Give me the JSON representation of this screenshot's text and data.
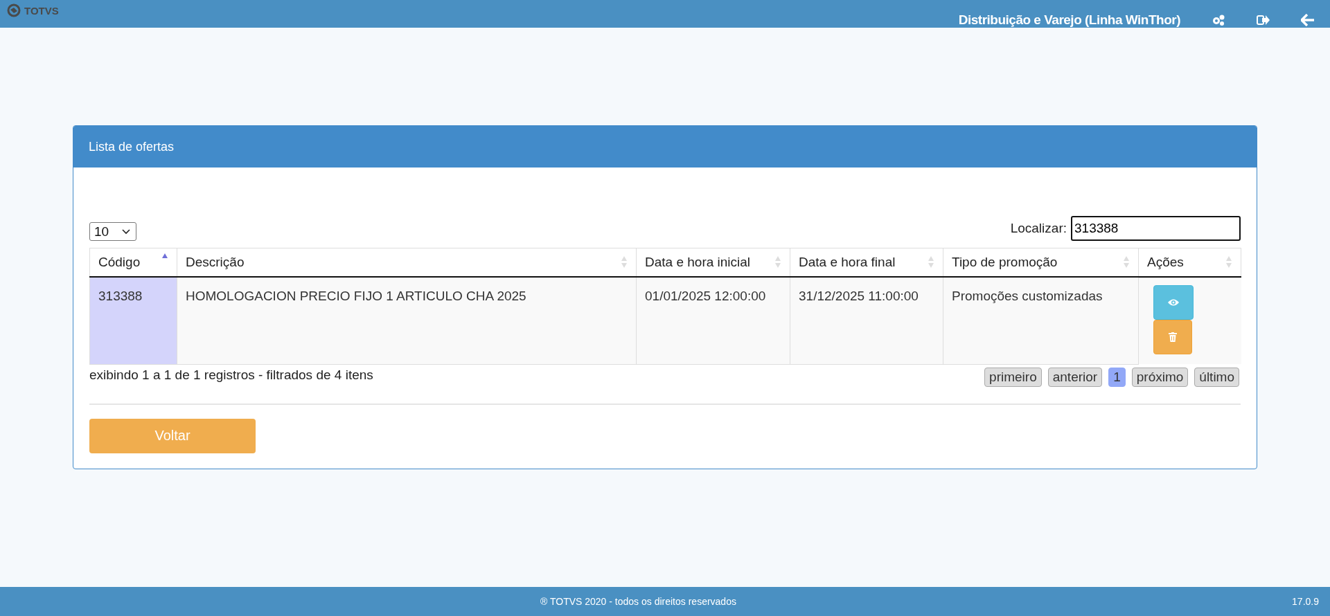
{
  "header": {
    "logo": "TOTVS",
    "title": "Distribuição e Varejo (Linha WinThor)"
  },
  "panel": {
    "title": "Lista de ofertas",
    "page_size": "10",
    "search": {
      "label": "Localizar:",
      "value": "313388"
    },
    "table": {
      "columns": [
        {
          "label": "Código",
          "sorted": true
        },
        {
          "label": "Descrição",
          "sorted": false
        },
        {
          "label": "Data e hora inicial",
          "sorted": false
        },
        {
          "label": "Data e hora final",
          "sorted": false
        },
        {
          "label": "Tipo de promoção",
          "sorted": false
        },
        {
          "label": "Ações",
          "sorted": false
        }
      ],
      "rows": [
        {
          "cells": [
            "313388",
            "HOMOLOGACION PRECIO FIJO 1 ARTICULO CHA 2025",
            "01/01/2025 12:00:00",
            "31/12/2025 11:00:00",
            "Promoções customizadas"
          ]
        }
      ]
    },
    "info": "exibindo 1 a 1 de 1 registros - filtrados de 4 itens",
    "pagination": [
      {
        "label": "primeiro",
        "selected": false
      },
      {
        "label": "anterior",
        "selected": false
      },
      {
        "label": "1",
        "selected": true
      },
      {
        "label": "próximo",
        "selected": false
      },
      {
        "label": "último",
        "selected": false
      }
    ],
    "back_button": "Voltar"
  },
  "footer": {
    "copyright": "® TOTVS 2020 - todos os direitos reservados",
    "version": "17.0.9"
  }
}
